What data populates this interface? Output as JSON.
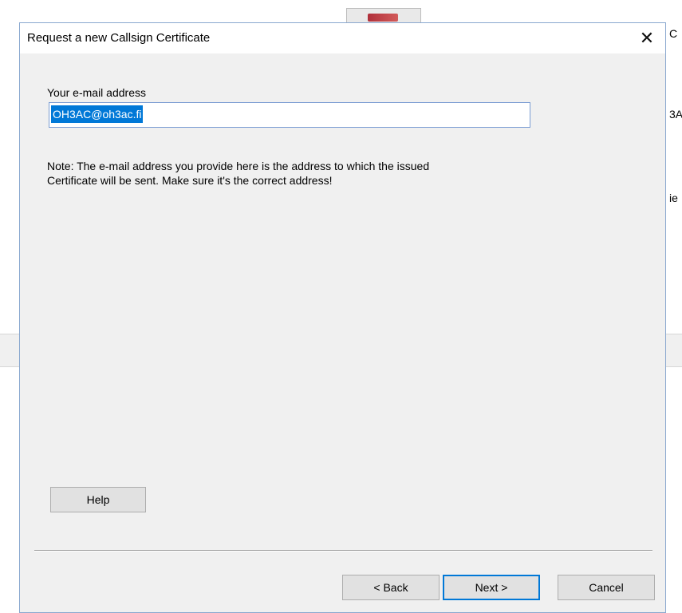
{
  "background": {
    "fragments": [
      "C",
      "3A",
      "ie"
    ]
  },
  "dialog": {
    "title": "Request a new Callsign Certificate",
    "close_glyph": "✕",
    "email_label": "Your e-mail address",
    "email_value": "OH3AC@oh3ac.fi",
    "note_line1": "Note: The e-mail address you provide here is the address to which the issued",
    "note_line2": "Certificate will be sent. Make sure it's the correct address!",
    "help_label": "Help",
    "back_label": "< Back",
    "next_label": "Next >",
    "cancel_label": "Cancel"
  },
  "colors": {
    "accent": "#0078d7",
    "dialog_bg": "#f0f0f0",
    "button_bg": "#e1e1e1"
  }
}
